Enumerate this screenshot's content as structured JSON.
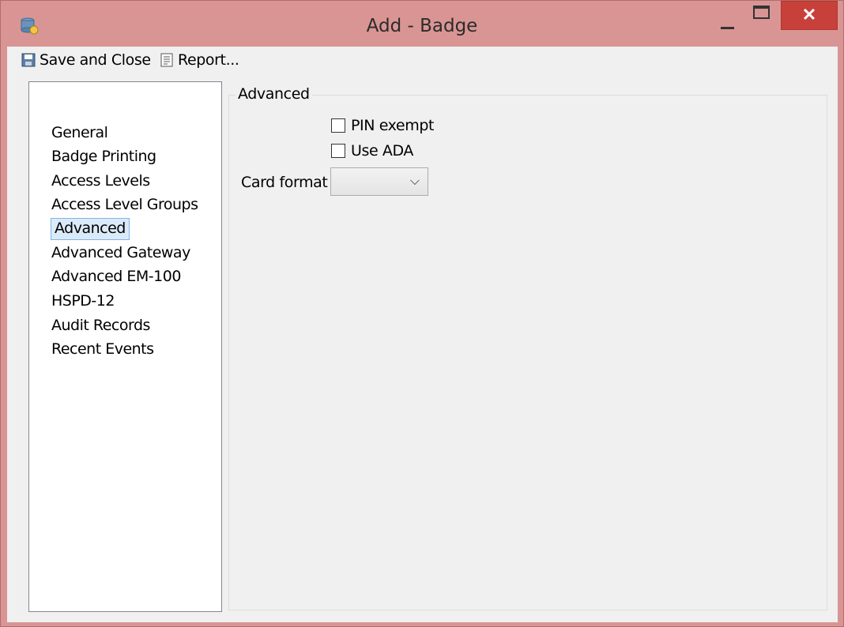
{
  "window": {
    "title": "Add - Badge",
    "close_glyph": "✕",
    "accent": "#d99593",
    "close_color": "#c7403a"
  },
  "toolbar": {
    "save_label": "Save and Close",
    "save_icon": "save-icon",
    "report_label": "Report...",
    "report_icon": "report-icon"
  },
  "nav": {
    "items": [
      {
        "label": "General"
      },
      {
        "label": "Badge Printing"
      },
      {
        "label": "Access Levels"
      },
      {
        "label": "Access Level Groups"
      },
      {
        "label": "Advanced",
        "selected": true
      },
      {
        "label": "Advanced Gateway"
      },
      {
        "label": "Advanced EM-100"
      },
      {
        "label": "HSPD-12"
      },
      {
        "label": "Audit Records"
      },
      {
        "label": "Recent Events"
      }
    ]
  },
  "advanced": {
    "group_label": "Advanced",
    "pin_exempt_label": "PIN exempt",
    "pin_exempt_checked": false,
    "use_ada_label": "Use ADA",
    "use_ada_checked": false,
    "card_format_label": "Card format",
    "card_format_value": "",
    "chevron_glyph": "⌵"
  }
}
